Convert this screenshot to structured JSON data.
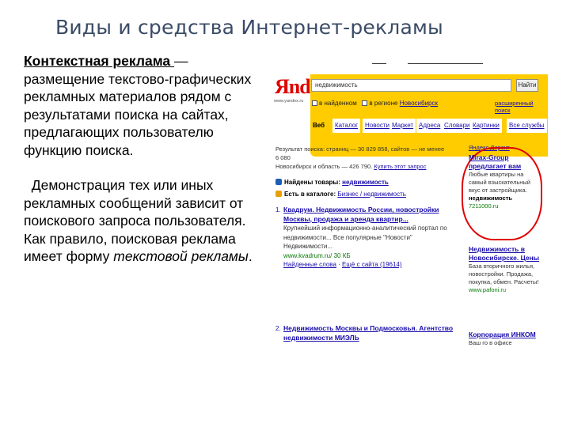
{
  "slide": {
    "title": "Виды и средства Интернет-рекламы",
    "term": "Контекстная реклама ",
    "definition": "— размещение текстово-графических рекламных материалов рядом с результатами поиска на сайтах, предлагающих пользователю функцию поиска.",
    "para2": "Демонстрация тех или иных рекламных сообщений зависит от поискового запроса пользователя.",
    "para3_start": "Как правило, поисковая реклама имеет форму ",
    "para3_italic": "текстовой рекламы",
    "para3_end": "."
  },
  "yandex": {
    "logo": "Яndex",
    "logo_sub": "www.yandex.ru",
    "search_value": "недвижимость",
    "find_label": "Найти",
    "check1": "в найденном",
    "check2": "в регионе",
    "region": "Новосибирск",
    "advanced": "расширенный поиск",
    "tabs": [
      "Веб",
      "Каталог",
      "Новости",
      "Маркет",
      "Адреса",
      "Словари",
      "Картинки",
      "Все службы"
    ],
    "results_line1": "Результат поиска: страниц — 30 829 858, сайтов — не менее 6 080",
    "results_line2": "Новосибирск и область — 426 790.",
    "results_link": "Купить этот запрос",
    "found_goods_label": "Найдены товары:",
    "found_goods_link": "недвижимость",
    "catalog_label": "Есть в каталоге:",
    "catalog_link": "Бизнес / недвижимость",
    "result1": {
      "num": "1.",
      "head": "Квадрум. Недвижимость России, новостройки Москвы, продажа и аренда квартир...",
      "snip": "Крупнейший информационно-аналитический портал по недвижимости... Все популярные \"Новости\" Недвижимости...",
      "url": "www.kvadrum.ru/ 30 КБ",
      "extra1": "Найденные слова",
      "extra2": "Ещё с сайта (19614)"
    },
    "result2": {
      "num": "2.",
      "head": "Недвижимость Москвы и Подмосковья. Агентство недвижимости МИЭЛЬ"
    },
    "direct_label": "Яндекс.Директ",
    "ads": [
      {
        "head": "Mirax-Group предлагает вам",
        "text": "Любые квартиры на самый взыскательный вкус от застройщика.",
        "bold": "недвижимость",
        "url": "7211000.ru"
      },
      {
        "head": "Недвижимость в Новосибирске. Цены",
        "text": "База вторичного жилья, новостройки. Продажа, покупка, обмен. Расчеты!",
        "url": "www.pafoni.ru"
      },
      {
        "head": "Корпорация ИНКОМ",
        "text": "Ваш го в офисе"
      }
    ]
  }
}
